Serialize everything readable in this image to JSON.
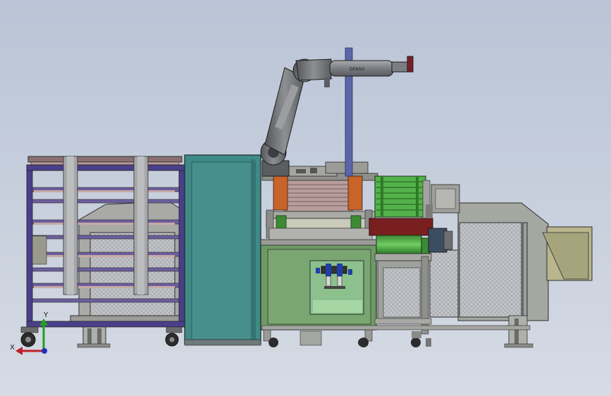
{
  "viewport": {
    "background_top": "#b9c4d6",
    "background_bottom": "#d6dbe4"
  },
  "robot_arm": {
    "body_color": "#6d6e72",
    "tool_marking": "DENSO",
    "tool_color": "#8a8b90"
  },
  "conveyor": {
    "frame_color": "#4a3f8a",
    "panel_color": "#3f8a86"
  },
  "control_cabinet": {
    "body_color": "#6f9a66",
    "panel_color": "#8cc08c"
  },
  "drum_unit": {
    "color": "#53b24a",
    "belt_color": "#7a1f1f"
  },
  "hopper": {
    "color": "#a8ab9a",
    "color_light": "#c9caba"
  },
  "triad": {
    "x_label": "X",
    "y_label": "Y",
    "x_color": "#c0202a",
    "y_color": "#20a020",
    "z_color": "#2030c0"
  }
}
